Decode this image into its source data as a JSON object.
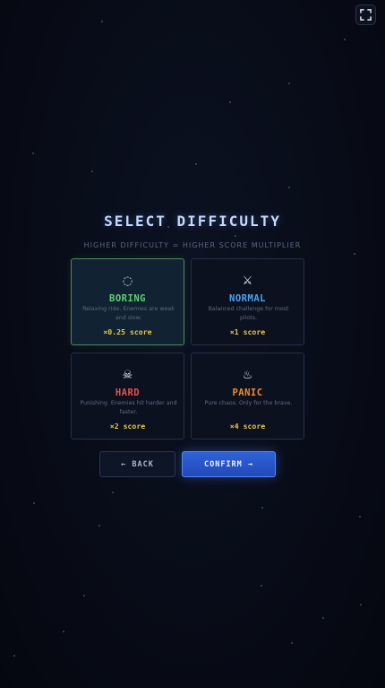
{
  "screen": {
    "title": "SELECT DIFFICULTY",
    "subtitle": "HIGHER DIFFICULTY = HIGHER SCORE MULTIPLIER"
  },
  "difficulties": [
    {
      "id": "boring",
      "icon": "circle-arrows-icon",
      "glyph": "◌",
      "name": "BORING",
      "color": "#5fcf72",
      "description": "Relaxing ride. Enemies are weak and slow.",
      "multiplier": "×0.25 score",
      "selected": true
    },
    {
      "id": "normal",
      "icon": "crossed-swords-icon",
      "glyph": "⚔",
      "name": "NORMAL",
      "color": "#4aa3ef",
      "description": "Balanced challenge for most pilots.",
      "multiplier": "×1 score",
      "selected": false
    },
    {
      "id": "hard",
      "icon": "skull-crossbones-icon",
      "glyph": "☠",
      "name": "HARD",
      "color": "#e0524a",
      "description": "Punishing. Enemies hit harder and faster.",
      "multiplier": "×2 score",
      "selected": false
    },
    {
      "id": "panic",
      "icon": "fire-icon",
      "glyph": "♨",
      "name": "PANIC",
      "color": "#f08a2c",
      "description": "Pure chaos. Only for the brave.",
      "multiplier": "×4 score",
      "selected": false
    }
  ],
  "buttons": {
    "back": "← BACK",
    "confirm": "CONFIRM →"
  },
  "colors": {
    "multiplier": "#e6c64a",
    "confirm_button": "#2f62d8"
  }
}
